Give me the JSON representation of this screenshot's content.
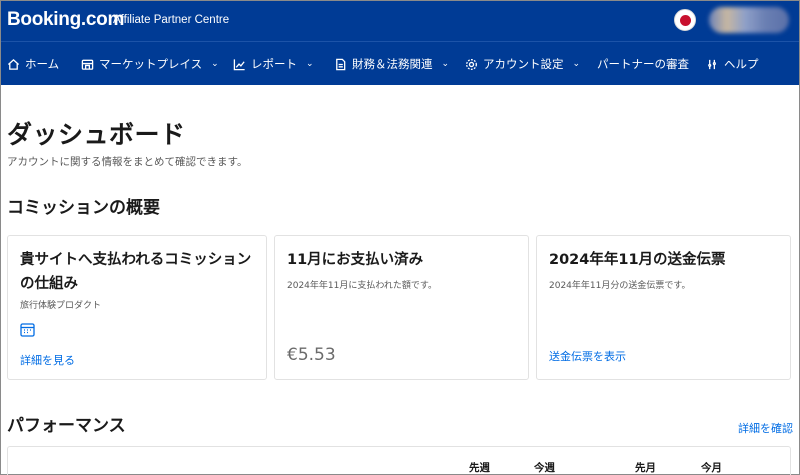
{
  "header": {
    "brand": "Booking.com",
    "subtitle": "Affiliate Partner Centre"
  },
  "nav": {
    "items": [
      {
        "label": "ホーム",
        "icon": "home-icon"
      },
      {
        "label": "マーケットプレイス",
        "icon": "store-icon",
        "dropdown": true
      },
      {
        "label": "レポート",
        "icon": "chart-icon",
        "dropdown": true
      },
      {
        "label": "財務＆法務関連",
        "icon": "document-icon",
        "dropdown": true
      },
      {
        "label": "アカウント設定",
        "icon": "gear-icon",
        "dropdown": true
      },
      {
        "label": "パートナーの審査",
        "icon": null
      },
      {
        "label": "ヘルプ",
        "icon": "help-icon"
      }
    ]
  },
  "page": {
    "title": "ダッシュボード",
    "subtitle": "アカウントに関する情報をまとめて確認できます。"
  },
  "commission": {
    "section_title": "コミッションの概要",
    "cards": [
      {
        "title": "貴サイトへ支払われるコミッションの仕組み",
        "desc": "旅行体験プロダクト",
        "link": "詳細を見る"
      },
      {
        "title": "11月にお支払い済み",
        "desc": "2024年年11月に支払われた額です。",
        "amount": "€5.53"
      },
      {
        "title": "2024年年11月の送金伝票",
        "desc": "2024年年11月分の送金伝票です。",
        "link": "送金伝票を表示"
      }
    ]
  },
  "performance": {
    "section_title": "パフォーマンス",
    "link": "詳細を確認",
    "columns": [
      "先週",
      "今週",
      "先月",
      "今月"
    ]
  },
  "colors": {
    "brand_blue": "#003b95",
    "link_blue": "#006ce4"
  }
}
